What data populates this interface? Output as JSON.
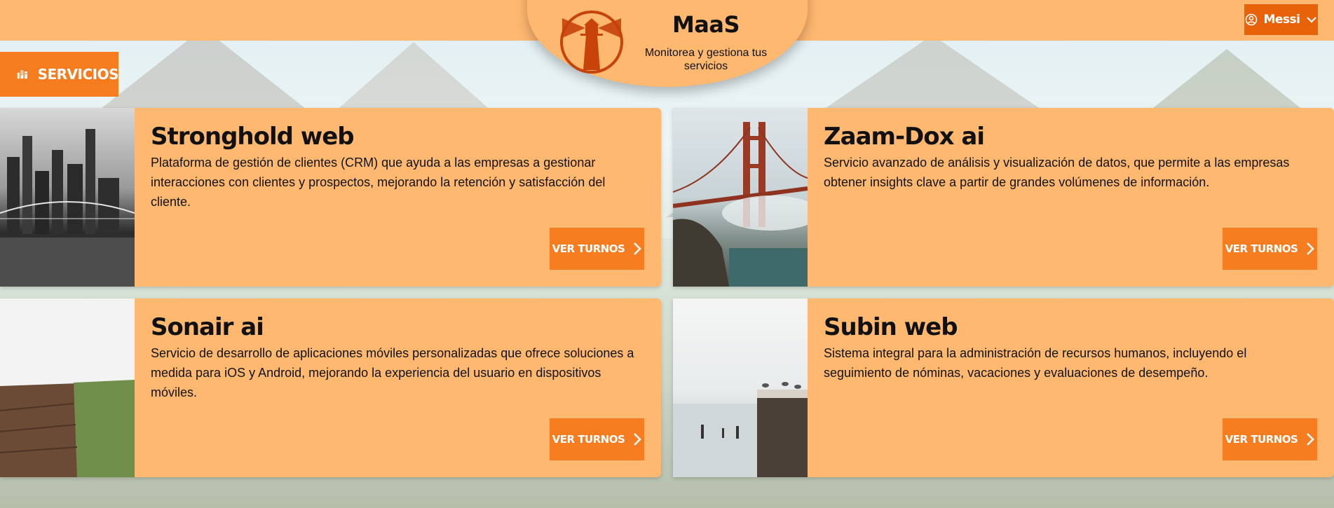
{
  "brand": {
    "title": "MaaS",
    "subtitle": "Monitorea y gestiona tus servicios",
    "logo_icon": "lighthouse-icon"
  },
  "user_menu": {
    "label": "Messi",
    "icon": "user-circle-icon",
    "chevron": "chevron-down-icon"
  },
  "section": {
    "label": "SERVICIOS",
    "icon": "services-icon"
  },
  "colors": {
    "header": "#ffb870",
    "accent": "#f57c1f",
    "accent_dark": "#e8620a",
    "logo": "#c7430a"
  },
  "services": [
    {
      "title": "Stronghold web",
      "description": "Plataforma de gestión de clientes (CRM) que ayuda a las empresas a gestionar interacciones con clientes y prospectos, mejorando la retención y satisfacción del cliente.",
      "button": "VER TURNOS"
    },
    {
      "title": "Zaam-Dox ai",
      "description": "Servicio avanzado de análisis y visualización de datos, que permite a las empresas obtener insights clave a partir de grandes volúmenes de información.",
      "button": "VER TURNOS"
    },
    {
      "title": "Sonair ai",
      "description": "Servicio de desarrollo de aplicaciones móviles personalizadas que ofrece soluciones a medida para iOS y Android, mejorando la experiencia del usuario en dispositivos móviles.",
      "button": "VER TURNOS"
    },
    {
      "title": "Subin web",
      "description": "Sistema integral para la administración de recursos humanos, incluyendo el seguimiento de nóminas, vacaciones y evaluaciones de desempeño.",
      "button": "VER TURNOS"
    }
  ]
}
